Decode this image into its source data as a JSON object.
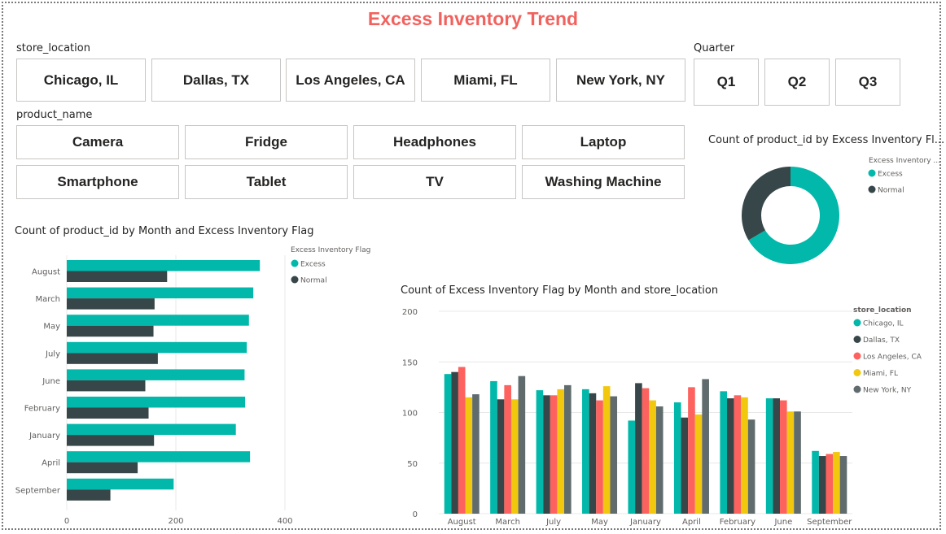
{
  "report": {
    "title": "Excess Inventory Trend",
    "title_color": "#F1625E"
  },
  "colors": {
    "excess": "#01B8AA",
    "normal": "#374649",
    "chicago": "#01B8AA",
    "dallas": "#374649",
    "los_angeles": "#FD625E",
    "miami": "#F2C80F",
    "new_york": "#5F6B6D",
    "axis_text": "#605E5C",
    "grid": "#E8E8E8"
  },
  "store_slicer": {
    "label": "store_location",
    "options": [
      "Chicago, IL",
      "Dallas, TX",
      "Los Angeles, CA",
      "Miami, FL",
      "New York, NY"
    ]
  },
  "quarter_slicer": {
    "label": "Quarter",
    "options": [
      "Q1",
      "Q2",
      "Q3"
    ]
  },
  "product_slicer": {
    "label": "product_name",
    "options": [
      "Camera",
      "Fridge",
      "Headphones",
      "Laptop",
      "Smartphone",
      "Tablet",
      "TV",
      "Washing Machine"
    ]
  },
  "chart_data": [
    {
      "type": "bar",
      "orientation": "horizontal",
      "title": "Count of product_id by Month and Excess Inventory Flag",
      "legend_title": "Excess Inventory Flag",
      "legend_position": "top-right",
      "categories": [
        "August",
        "March",
        "May",
        "July",
        "June",
        "February",
        "January",
        "April",
        "September"
      ],
      "series": [
        {
          "name": "Excess",
          "values": [
            354,
            342,
            334,
            330,
            326,
            327,
            310,
            336,
            196
          ]
        },
        {
          "name": "Normal",
          "values": [
            184,
            161,
            159,
            167,
            144,
            150,
            160,
            130,
            80
          ]
        }
      ],
      "xlim": [
        0,
        400
      ],
      "x_ticks": [
        "0",
        "200",
        "400"
      ],
      "grid": true
    },
    {
      "type": "pie",
      "donut": true,
      "title": "Count of product_id by Excess Inventory Fl...",
      "legend_title": "Excess Inventory ...",
      "legend_position": "right",
      "labels": [
        "Excess",
        "Normal"
      ],
      "values": [
        66.5,
        33.5
      ]
    },
    {
      "type": "bar",
      "title": "Count of Excess Inventory Flag by Month and store_location",
      "legend_title": "store_location",
      "legend_position": "right",
      "categories": [
        "August",
        "March",
        "July",
        "May",
        "January",
        "April",
        "February",
        "June",
        "September"
      ],
      "series": [
        {
          "name": "Chicago, IL",
          "values": [
            138,
            131,
            122,
            123,
            92,
            110,
            121,
            114,
            62
          ]
        },
        {
          "name": "Dallas, TX",
          "values": [
            140,
            113,
            117,
            119,
            129,
            95,
            114,
            114,
            57
          ]
        },
        {
          "name": "Los Angeles, CA",
          "values": [
            145,
            127,
            117,
            112,
            124,
            125,
            117,
            112,
            59
          ]
        },
        {
          "name": "Miami, FL",
          "values": [
            115,
            113,
            123,
            126,
            112,
            98,
            115,
            101,
            61
          ]
        },
        {
          "name": "New York, NY",
          "values": [
            118,
            136,
            127,
            116,
            106,
            133,
            93,
            101,
            57
          ]
        }
      ],
      "ylim": [
        0,
        200
      ],
      "y_ticks": [
        "0",
        "50",
        "100",
        "150",
        "200"
      ],
      "grid": true
    }
  ]
}
